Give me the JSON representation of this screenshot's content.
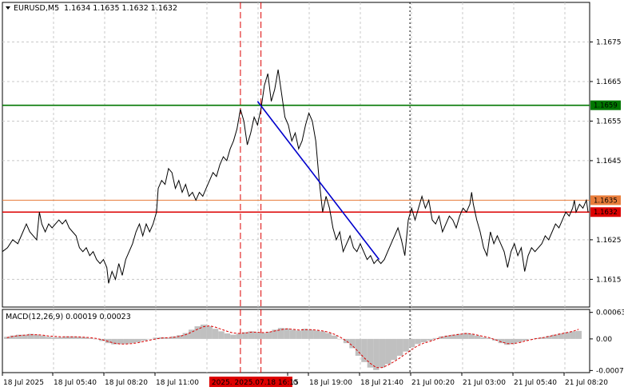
{
  "header": {
    "symbol": "EURUSD,M5",
    "ohlc": "1.1634 1.1635 1.1632 1.1632"
  },
  "colors": {
    "price_line": "#000000",
    "trend_line": "#0000cc",
    "green_level": "#007700",
    "orange_level": "#e87c3a",
    "red_level": "#dd0000",
    "grid": "#c8c8c8",
    "histogram": "#c0c0c0",
    "signal": "#dd0000",
    "vline_red": "#dd0000"
  },
  "price_axis": {
    "ticks": [
      "1.1675",
      "1.1665",
      "1.1655",
      "1.1645",
      "1.1625",
      "1.1615"
    ],
    "range": [
      1.1608,
      1.1685
    ]
  },
  "levels": [
    {
      "value": 1.1659,
      "label": "1.1659",
      "color": "#007700"
    },
    {
      "value": 1.1635,
      "label": "1.1635",
      "color": "#e87c3a"
    },
    {
      "value": 1.1632,
      "label": "1.1632",
      "color": "#dd0000"
    }
  ],
  "macd": {
    "title": "MACD(12,26,9) 0.00019 0.00023",
    "ticks": [
      "0.00063",
      "0.00",
      "-0.00075"
    ],
    "range": [
      -0.0008,
      0.0007
    ]
  },
  "time_axis": {
    "labels": [
      "18 Jul 2025",
      "18 Jul 05:40",
      "18 Jul 08:20",
      "18 Jul 11:00",
      "20",
      "18 Jul 19:00",
      "18 Jul 21:40",
      "21 Jul 00:20",
      "21 Jul 03:00",
      "21 Jul 05:40",
      "21 Jul 08:20"
    ],
    "highlight": "2025. 2025.07.18 16:15"
  },
  "chart_data": {
    "type": "line",
    "title": "EURUSD,M5",
    "price_series": [
      [
        0,
        1.1622
      ],
      [
        1.5,
        1.1623
      ],
      [
        3,
        1.1625
      ],
      [
        4.5,
        1.1624
      ],
      [
        6,
        1.1627
      ],
      [
        7,
        1.1629
      ],
      [
        8,
        1.1627
      ],
      [
        9,
        1.1626
      ],
      [
        10,
        1.1625
      ],
      [
        10.8,
        1.1632
      ],
      [
        11.5,
        1.1629
      ],
      [
        12.5,
        1.1627
      ],
      [
        13.5,
        1.1629
      ],
      [
        14.5,
        1.1628
      ],
      [
        15.5,
        1.1629
      ],
      [
        16.5,
        1.163
      ],
      [
        17.5,
        1.1629
      ],
      [
        18.5,
        1.163
      ],
      [
        19.5,
        1.1628
      ],
      [
        20.5,
        1.1627
      ],
      [
        21.5,
        1.1626
      ],
      [
        22.5,
        1.1623
      ],
      [
        23.5,
        1.1622
      ],
      [
        24.5,
        1.1623
      ],
      [
        25.5,
        1.1621
      ],
      [
        26.5,
        1.1622
      ],
      [
        27.5,
        1.162
      ],
      [
        28.5,
        1.1619
      ],
      [
        29.5,
        1.162
      ],
      [
        30.5,
        1.1618
      ],
      [
        31,
        1.1614
      ],
      [
        32,
        1.1617
      ],
      [
        33,
        1.1615
      ],
      [
        34,
        1.1619
      ],
      [
        35,
        1.1616
      ],
      [
        36,
        1.162
      ],
      [
        37,
        1.1622
      ],
      [
        38,
        1.1624
      ],
      [
        39,
        1.1627
      ],
      [
        40,
        1.1629
      ],
      [
        41,
        1.1626
      ],
      [
        42,
        1.1629
      ],
      [
        43,
        1.1627
      ],
      [
        44,
        1.1629
      ],
      [
        45,
        1.1632
      ],
      [
        45.5,
        1.1638
      ],
      [
        46.5,
        1.164
      ],
      [
        47.5,
        1.1639
      ],
      [
        48.5,
        1.1643
      ],
      [
        49.5,
        1.1642
      ],
      [
        50.5,
        1.1638
      ],
      [
        51.5,
        1.164
      ],
      [
        52.5,
        1.1637
      ],
      [
        53.5,
        1.1639
      ],
      [
        54.5,
        1.1636
      ],
      [
        55.5,
        1.1637
      ],
      [
        56.5,
        1.1635
      ],
      [
        57.5,
        1.1637
      ],
      [
        58.5,
        1.1636
      ],
      [
        59.5,
        1.1638
      ],
      [
        60.5,
        1.164
      ],
      [
        61.5,
        1.1642
      ],
      [
        62.5,
        1.1641
      ],
      [
        63.5,
        1.1644
      ],
      [
        64.5,
        1.1646
      ],
      [
        65.5,
        1.1645
      ],
      [
        66.5,
        1.1648
      ],
      [
        67.5,
        1.165
      ],
      [
        68.5,
        1.1653
      ],
      [
        69.5,
        1.1658
      ],
      [
        70.5,
        1.1655
      ],
      [
        71.5,
        1.1649
      ],
      [
        72.5,
        1.1652
      ],
      [
        73.5,
        1.1656
      ],
      [
        74.5,
        1.1654
      ],
      [
        75.5,
        1.1658
      ],
      [
        76.5,
        1.1664
      ],
      [
        77.5,
        1.1667
      ],
      [
        78.5,
        1.166
      ],
      [
        79.5,
        1.1663
      ],
      [
        80.5,
        1.1668
      ],
      [
        81.5,
        1.1662
      ],
      [
        82.5,
        1.1656
      ],
      [
        83.5,
        1.1654
      ],
      [
        84.5,
        1.165
      ],
      [
        85.5,
        1.1652
      ],
      [
        86.5,
        1.1648
      ],
      [
        87.5,
        1.165
      ],
      [
        88.5,
        1.1654
      ],
      [
        89.5,
        1.1657
      ],
      [
        90.5,
        1.1655
      ],
      [
        91.5,
        1.165
      ],
      [
        92.5,
        1.164
      ],
      [
        93.5,
        1.1632
      ],
      [
        94.5,
        1.1636
      ],
      [
        95.5,
        1.1633
      ],
      [
        96.5,
        1.1628
      ],
      [
        97.5,
        1.1625
      ],
      [
        98.5,
        1.1627
      ],
      [
        99.5,
        1.1622
      ],
      [
        100.5,
        1.1624
      ],
      [
        101.5,
        1.1626
      ],
      [
        102.5,
        1.1623
      ],
      [
        103.5,
        1.1622
      ],
      [
        104.5,
        1.1624
      ],
      [
        105.5,
        1.1622
      ],
      [
        106.5,
        1.162
      ],
      [
        107.5,
        1.1621
      ],
      [
        108.5,
        1.1619
      ],
      [
        109.5,
        1.162
      ],
      [
        110.5,
        1.1619
      ],
      [
        111.5,
        1.162
      ],
      [
        112.5,
        1.1622
      ],
      [
        113.5,
        1.1624
      ],
      [
        114.5,
        1.1626
      ],
      [
        115.5,
        1.1628
      ],
      [
        116.5,
        1.1625
      ],
      [
        117.5,
        1.1621
      ],
      [
        118.5,
        1.163
      ],
      [
        119.5,
        1.1633
      ],
      [
        120.5,
        1.163
      ],
      [
        121.5,
        1.1633
      ],
      [
        122.5,
        1.1636
      ],
      [
        123.5,
        1.1633
      ],
      [
        124.5,
        1.1635
      ],
      [
        125.5,
        1.163
      ],
      [
        126.5,
        1.1629
      ],
      [
        127.5,
        1.1631
      ],
      [
        128.5,
        1.1627
      ],
      [
        129.5,
        1.1629
      ],
      [
        130.5,
        1.1631
      ],
      [
        131.5,
        1.163
      ],
      [
        132.5,
        1.1628
      ],
      [
        133.5,
        1.1631
      ],
      [
        134.5,
        1.1633
      ],
      [
        135.5,
        1.1632
      ],
      [
        136.5,
        1.1634
      ],
      [
        137,
        1.1637
      ],
      [
        137.5,
        1.1634
      ],
      [
        138.5,
        1.163
      ],
      [
        139.5,
        1.1627
      ],
      [
        140.5,
        1.1623
      ],
      [
        141.5,
        1.1621
      ],
      [
        142.5,
        1.1627
      ],
      [
        143.5,
        1.1624
      ],
      [
        144.5,
        1.1626
      ],
      [
        145.5,
        1.1624
      ],
      [
        146.5,
        1.1622
      ],
      [
        147.5,
        1.1618
      ],
      [
        148.5,
        1.1622
      ],
      [
        149.5,
        1.1624
      ],
      [
        150.5,
        1.1621
      ],
      [
        151.5,
        1.1623
      ],
      [
        152.5,
        1.1617
      ],
      [
        153.5,
        1.1621
      ],
      [
        154.5,
        1.1623
      ],
      [
        155.5,
        1.1622
      ],
      [
        156.5,
        1.1623
      ],
      [
        157.5,
        1.1624
      ],
      [
        158.5,
        1.1626
      ],
      [
        159.5,
        1.1625
      ],
      [
        160.5,
        1.1627
      ],
      [
        161.5,
        1.1629
      ],
      [
        162.5,
        1.1628
      ],
      [
        163.5,
        1.163
      ],
      [
        164.5,
        1.1632
      ],
      [
        165.5,
        1.1631
      ],
      [
        166.5,
        1.1633
      ],
      [
        167,
        1.1635
      ],
      [
        167.5,
        1.1632
      ],
      [
        168.5,
        1.1634
      ],
      [
        169.5,
        1.1633
      ],
      [
        170.5,
        1.1635
      ],
      [
        171,
        1.1632
      ]
    ],
    "trend_line": [
      [
        74.5,
        1.166
      ],
      [
        110,
        1.162
      ]
    ],
    "vertical_lines": [
      69.5,
      75.5
    ],
    "cursor_line": 119,
    "macd_histogram": [
      5e-05,
      8e-05,
      0.0001,
      0.0001,
      0.00012,
      0.0001,
      8e-05,
      5e-05,
      4e-05,
      4e-05,
      6e-05,
      6e-05,
      5e-05,
      4e-05,
      2e-05,
      0.0,
      -5e-05,
      -0.0001,
      -0.00013,
      -0.00012,
      -0.00012,
      -0.0001,
      -8e-05,
      -4e-05,
      0.0,
      3e-05,
      4e-05,
      3e-05,
      6e-05,
      9e-05,
      0.00014,
      0.00022,
      0.0003,
      0.00034,
      0.0003,
      0.00024,
      0.00018,
      0.00013,
      0.0001,
      0.00012,
      0.00016,
      0.00018,
      0.00016,
      0.00014,
      0.00017,
      0.00022,
      0.00026,
      0.00025,
      0.00022,
      0.0002,
      0.00024,
      0.00022,
      0.0002,
      0.00018,
      0.00014,
      8e-05,
      0.0,
      -0.0001,
      -0.00022,
      -0.0004,
      -0.00055,
      -0.00068,
      -0.00074,
      -0.00068,
      -0.0006,
      -0.0005,
      -0.0004,
      -0.0003,
      -0.0002,
      -0.00012,
      -8e-05,
      -4e-05,
      2e-05,
      6e-05,
      8e-05,
      0.0001,
      0.00012,
      0.00014,
      0.00012,
      8e-05,
      4e-05,
      2e-05,
      -4e-05,
      -0.0001,
      -0.00014,
      -0.00012,
      -8e-05,
      -4e-05,
      0.0,
      2e-05,
      4e-05,
      7e-05,
      0.0001,
      0.00013,
      0.00016,
      0.00018,
      0.00019
    ],
    "macd_signal": [
      3e-05,
      6e-05,
      8e-05,
      9e-05,
      0.0001,
      0.0001,
      9e-05,
      7e-05,
      6e-05,
      5e-05,
      5e-05,
      5e-05,
      5e-05,
      4e-05,
      3e-05,
      1e-05,
      -2e-05,
      -6e-05,
      -0.0001,
      -0.00012,
      -0.00012,
      -0.00011,
      -9e-05,
      -6e-05,
      -3e-05,
      0.0,
      2e-05,
      3e-05,
      4e-05,
      6e-05,
      0.0001,
      0.00016,
      0.00023,
      0.00029,
      0.00031,
      0.00028,
      0.00023,
      0.00018,
      0.00014,
      0.00013,
      0.00014,
      0.00016,
      0.00016,
      0.00015,
      0.00016,
      0.00019,
      0.00022,
      0.00024,
      0.00023,
      0.00021,
      0.00022,
      0.00022,
      0.00021,
      0.00019,
      0.00016,
      0.00011,
      4e-05,
      -5e-05,
      -0.00016,
      -0.0003,
      -0.00045,
      -0.00058,
      -0.00068,
      -0.00068,
      -0.00062,
      -0.00054,
      -0.00045,
      -0.00035,
      -0.00025,
      -0.00016,
      -0.0001,
      -6e-05,
      -1e-05,
      4e-05,
      7e-05,
      9e-05,
      0.00011,
      0.00013,
      0.00012,
      9e-05,
      6e-05,
      3e-05,
      -2e-05,
      -7e-05,
      -0.00011,
      -0.00011,
      -9e-05,
      -5e-05,
      -2e-05,
      1e-05,
      3e-05,
      6e-05,
      9e-05,
      0.00012,
      0.00015,
      0.00018,
      0.00023
    ]
  }
}
